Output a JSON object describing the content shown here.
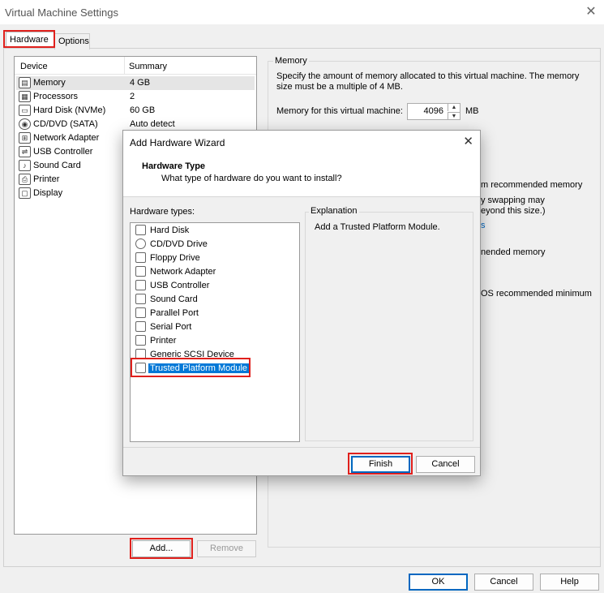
{
  "window": {
    "title": "Virtual Machine Settings",
    "close_glyph": "✕"
  },
  "tabs": [
    {
      "label": "Hardware"
    },
    {
      "label": "Options"
    }
  ],
  "device_list": {
    "col_device": "Device",
    "col_summary": "Summary",
    "devices": [
      {
        "name": "Memory",
        "summary": "4 GB",
        "icon": "memory-icon"
      },
      {
        "name": "Processors",
        "summary": "2",
        "icon": "cpu-icon"
      },
      {
        "name": "Hard Disk (NVMe)",
        "summary": "60 GB",
        "icon": "hard-disk-icon"
      },
      {
        "name": "CD/DVD (SATA)",
        "summary": "Auto detect",
        "icon": "cd-icon"
      },
      {
        "name": "Network Adapter",
        "summary": "",
        "icon": "network-icon"
      },
      {
        "name": "USB Controller",
        "summary": "",
        "icon": "usb-icon"
      },
      {
        "name": "Sound Card",
        "summary": "",
        "icon": "sound-icon"
      },
      {
        "name": "Printer",
        "summary": "",
        "icon": "printer-icon"
      },
      {
        "name": "Display",
        "summary": "",
        "icon": "display-icon"
      }
    ]
  },
  "buttons": {
    "add": "Add...",
    "remove": "Remove",
    "ok": "OK",
    "cancel": "Cancel",
    "help": "Help"
  },
  "memory": {
    "legend": "Memory",
    "desc_line1": "Specify the amount of memory allocated to this virtual machine. The memory",
    "desc_line2": "size must be a multiple of 4 MB.",
    "field_label": "Memory for this virtual machine:",
    "value": "4096",
    "unit": "MB",
    "partial1": "m recommended memory",
    "partial2": "y swapping may",
    "partial3": "eyond this size.)",
    "partial4": "s",
    "partial5": "nended memory",
    "partial6": "OS recommended minimum"
  },
  "wizard": {
    "title": "Add Hardware Wizard",
    "close_glyph": "✕",
    "heading": "Hardware Type",
    "subheading": "What type of hardware do you want to install?",
    "types_label": "Hardware types:",
    "types": [
      {
        "name": "Hard Disk",
        "icon": "hard-disk-icon"
      },
      {
        "name": "CD/DVD Drive",
        "icon": "cd-icon"
      },
      {
        "name": "Floppy Drive",
        "icon": "floppy-icon"
      },
      {
        "name": "Network Adapter",
        "icon": "network-icon"
      },
      {
        "name": "USB Controller",
        "icon": "usb-icon"
      },
      {
        "name": "Sound Card",
        "icon": "sound-icon"
      },
      {
        "name": "Parallel Port",
        "icon": "parallel-port-icon"
      },
      {
        "name": "Serial Port",
        "icon": "serial-port-icon"
      },
      {
        "name": "Printer",
        "icon": "printer-icon"
      },
      {
        "name": "Generic SCSI Device",
        "icon": "scsi-icon"
      },
      {
        "name": "Trusted Platform Module",
        "icon": "tpm-icon",
        "selected": true
      }
    ],
    "explanation_label": "Explanation",
    "explanation_text": "Add a Trusted Platform Module.",
    "finish": "Finish",
    "cancel": "Cancel"
  }
}
